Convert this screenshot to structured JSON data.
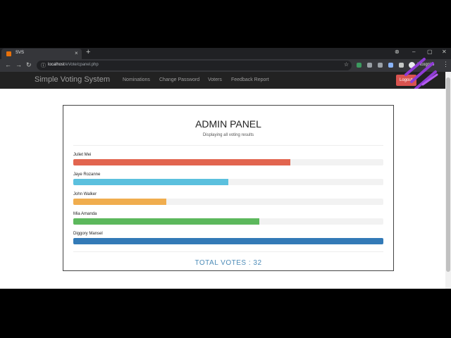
{
  "browser": {
    "tab_title": "SVS",
    "tab_close": "×",
    "new_tab": "+",
    "url_host": "localhost",
    "url_path": "/eVote/cpanel.php",
    "incognito_label": "Incognito",
    "window_controls": [
      "–",
      "▢",
      "✕"
    ]
  },
  "navbar": {
    "brand": "Simple Voting System",
    "links": [
      "Nominations",
      "Change Password",
      "Voters",
      "Feedback Report"
    ],
    "logout_label": "Logout"
  },
  "panel": {
    "title": "ADMIN PANEL",
    "subtitle": "Displaying all voting results",
    "candidates": [
      {
        "name": "Juliet Mei",
        "share": 0.7,
        "color": "#e2654f"
      },
      {
        "name": "Jaye Rozanne",
        "share": 0.5,
        "color": "#5bc0de"
      },
      {
        "name": "John Walker",
        "share": 0.3,
        "color": "#f0ad4e"
      },
      {
        "name": "Mia Amanda",
        "share": 0.6,
        "color": "#5cb85c"
      },
      {
        "name": "Diggory Mansel",
        "share": 1.0,
        "color": "#337ab7"
      }
    ],
    "total_label": "TOTAL VOTES : 32"
  }
}
